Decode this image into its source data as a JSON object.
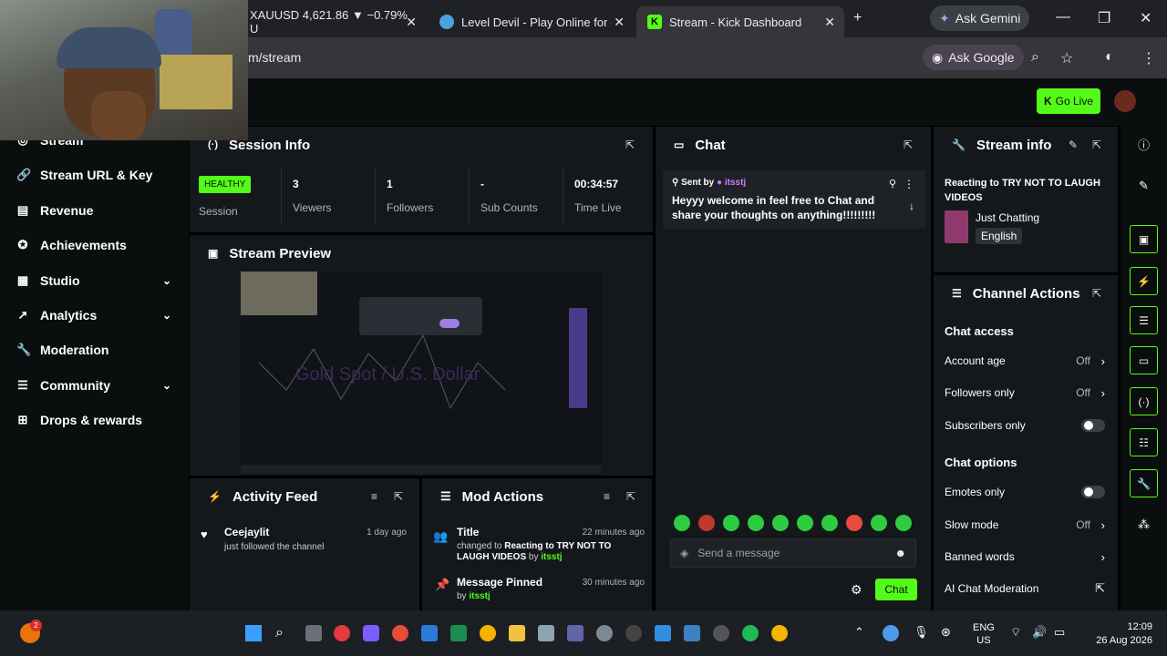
{
  "browser": {
    "tabs": [
      {
        "title": "XAUUSD 4,621.86 ▼ −0.79% U"
      },
      {
        "title": "Level Devil - Play Online for Fr"
      },
      {
        "title": "Stream - Kick Dashboard"
      }
    ],
    "ask_gemini": "Ask Gemini",
    "url": "m/stream",
    "ask_google": "Ask Google"
  },
  "header": {
    "go_live": "Go Live"
  },
  "sidebar": {
    "items": [
      {
        "label": "Stream",
        "icon": "broadcast-icon"
      },
      {
        "label": "Stream URL & Key",
        "icon": "link-icon"
      },
      {
        "label": "Revenue",
        "icon": "revenue-icon"
      },
      {
        "label": "Achievements",
        "icon": "medal-icon"
      },
      {
        "label": "Studio",
        "icon": "studio-icon",
        "expand": true
      },
      {
        "label": "Analytics",
        "icon": "analytics-icon",
        "expand": true
      },
      {
        "label": "Moderation",
        "icon": "wrench-icon"
      },
      {
        "label": "Community",
        "icon": "community-icon",
        "expand": true
      },
      {
        "label": "Drops & rewards",
        "icon": "gift-icon"
      }
    ]
  },
  "session": {
    "title": "Session Info",
    "status": "HEALTHY",
    "status_label": "Session",
    "stats": [
      {
        "value": "3",
        "label": "Viewers"
      },
      {
        "value": "1",
        "label": "Followers"
      },
      {
        "value": "-",
        "label": "Sub Counts"
      },
      {
        "value": "00:34:57",
        "label": "Time Live"
      }
    ]
  },
  "preview": {
    "title": "Stream Preview",
    "overlay_text": "Gold Spot / U.S. Dollar"
  },
  "activity": {
    "title": "Activity Feed",
    "items": [
      {
        "user": "Ceejaylit",
        "text": "just followed the channel",
        "time": "1 day ago"
      }
    ]
  },
  "mod_actions": {
    "title": "Mod Actions",
    "items": [
      {
        "title": "Title",
        "text_prefix": "changed to ",
        "text_bold": "Reacting to TRY NOT TO LAUGH VIDEOS",
        "by": "by ",
        "user": "itsstj",
        "time": "22 minutes ago"
      },
      {
        "title": "Message Pinned",
        "by": "by ",
        "user": "itsstj",
        "time": "30 minutes ago"
      }
    ]
  },
  "chat": {
    "title": "Chat",
    "pinned_sent_by": "Sent by",
    "pinned_user": "itsstj",
    "pinned_text": "Heyyy welcome in feel free to Chat and share your thoughts on anything!!!!!!!!!",
    "placeholder": "Send a message",
    "send_label": "Chat"
  },
  "stream_info": {
    "title": "Stream info",
    "stream_title": "Reacting to TRY NOT TO LAUGH VIDEOS",
    "category": "Just Chatting",
    "language": "English"
  },
  "channel_actions": {
    "title": "Channel Actions",
    "chat_access": "Chat access",
    "rows_access": [
      {
        "label": "Account age",
        "value": "Off"
      },
      {
        "label": "Followers only",
        "value": "Off"
      },
      {
        "label": "Subscribers only",
        "toggle": true
      }
    ],
    "chat_options": "Chat options",
    "rows_options": [
      {
        "label": "Emotes only",
        "toggle": true
      },
      {
        "label": "Slow mode",
        "value": "Off"
      },
      {
        "label": "Banned words"
      },
      {
        "label": "AI Chat Moderation"
      }
    ]
  },
  "taskbar": {
    "lang": "ENG",
    "region": "US",
    "time": "12:09",
    "date": "26 Aug 2026",
    "notif_count": "2"
  },
  "colors": {
    "accent": "#53fc18",
    "panel": "#15181b",
    "bg": "#000000"
  }
}
